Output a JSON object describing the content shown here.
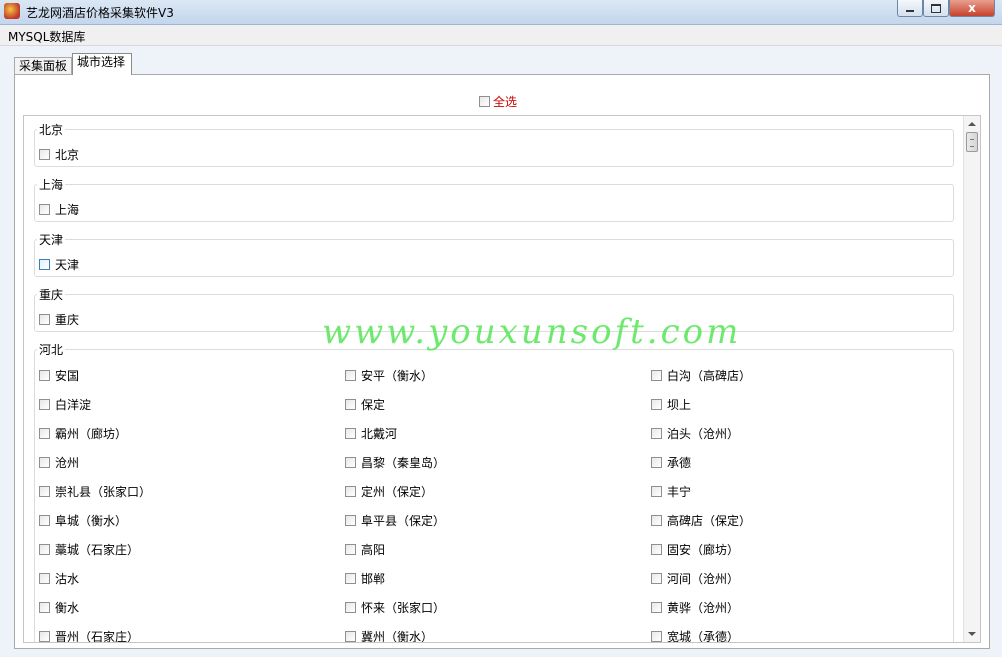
{
  "window": {
    "title": "艺龙网酒店价格采集软件V3",
    "close_symbol": "x"
  },
  "menu": {
    "items": [
      {
        "label": "MYSQL数据库"
      }
    ]
  },
  "tabs": [
    {
      "label": "采集面板",
      "active": false
    },
    {
      "label": "城市选择",
      "active": true
    }
  ],
  "select_all": {
    "label": "全选",
    "color": "#cc0000",
    "checked": false
  },
  "groups": [
    {
      "name": "北京",
      "cities": [
        "北京"
      ]
    },
    {
      "name": "上海",
      "cities": [
        "上海"
      ]
    },
    {
      "name": "天津",
      "cities": [
        "天津"
      ]
    },
    {
      "name": "重庆",
      "cities": [
        "重庆"
      ]
    },
    {
      "name": "河北",
      "cities": [
        "安国",
        "安平（衡水）",
        "白沟（高碑店）",
        "白洋淀",
        "保定",
        "坝上",
        "霸州（廊坊）",
        "北戴河",
        "泊头（沧州）",
        "沧州",
        "昌黎（秦皇岛）",
        "承德",
        "崇礼县（张家口）",
        "定州（保定）",
        "丰宁",
        "阜城（衡水）",
        "阜平县（保定）",
        "高碑店（保定）",
        "藁城（石家庄）",
        "高阳",
        "固安（廊坊）",
        "沽水",
        "邯郸",
        "河间（沧州）",
        "衡水",
        "怀来（张家口）",
        "黄骅（沧州）",
        "晋州（石家庄）",
        "冀州（衡水）",
        "宽城（承德）"
      ]
    }
  ],
  "watermark": "www.youxunsoft.com"
}
